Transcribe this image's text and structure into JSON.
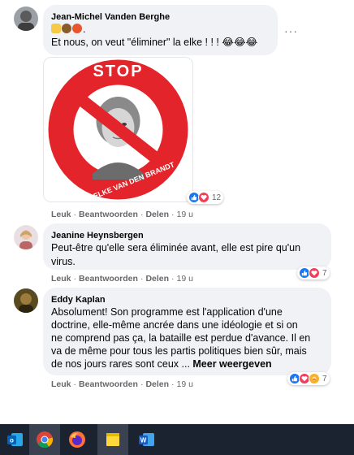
{
  "comments": [
    {
      "author": "Jean-Michel Vanden Berghe",
      "emoji_line": "👎💩😡.",
      "text": "Et nous, on veut \"éliminer\" la elke ! ! ! 😂😂😂",
      "menu_label": "···",
      "image": {
        "top_text": "STOP",
        "bottom_text": "ELKE VAN DEN BRANDT",
        "ring_color": "#e3242b"
      },
      "reactions": {
        "icons": [
          "like-icon",
          "love-icon"
        ],
        "count": "12"
      },
      "actions": {
        "like": "Leuk",
        "reply": "Beantwoorden",
        "share": "Delen",
        "time": "19 u"
      }
    },
    {
      "author": "Jeanine Heynsbergen",
      "text_line1": "Peut-être qu'elle sera éliminée avant, elle est pire qu'un",
      "text_line2": "virus.",
      "reactions": {
        "icons": [
          "like-icon",
          "love-icon"
        ],
        "count": "7"
      },
      "actions": {
        "like": "Leuk",
        "reply": "Beantwoorden",
        "share": "Delen",
        "time": "19 u"
      }
    },
    {
      "author": "Eddy Kaplan",
      "lines": [
        "Absolument! Son programme est l'application d'une",
        "doctrine, elle-même ancrée dans une idéologie et si on",
        "ne comprend pas ça, la bataille est perdue d'avance. Il en",
        "va de même pour tous les partis politiques bien sûr, mais",
        "de nos jours rares sont ceux ... "
      ],
      "more_label": "Meer weergeven",
      "reactions": {
        "icons": [
          "like-icon",
          "love-icon",
          "care-icon"
        ],
        "count": "7"
      },
      "actions": {
        "like": "Leuk",
        "reply": "Beantwoorden",
        "share": "Delen",
        "time": "19 u"
      }
    }
  ],
  "taskbar": {
    "apps": [
      "outlook-icon",
      "chrome-icon",
      "firefox-icon",
      "sticky-notes-icon",
      "word-icon"
    ],
    "colors": {
      "bg": "#1b2331",
      "accent": "#1877f2"
    }
  }
}
